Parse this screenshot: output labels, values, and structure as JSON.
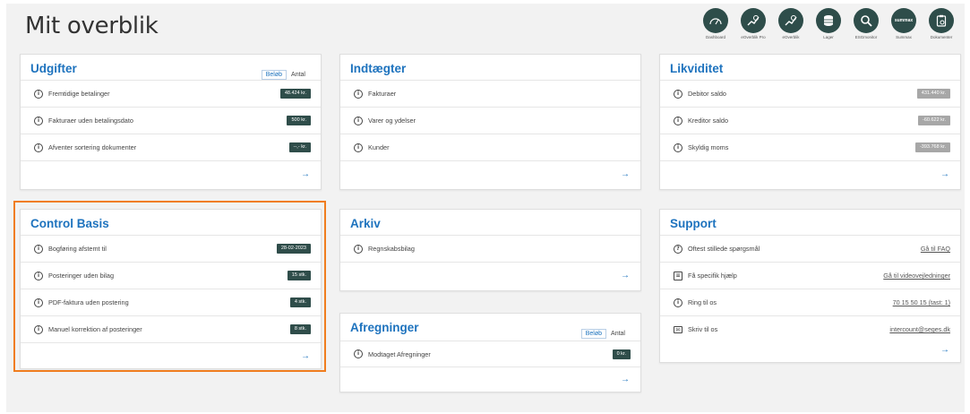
{
  "page": {
    "title": "Mit overblik"
  },
  "topnav": [
    {
      "label": "Dashboard",
      "icon": "gauge-icon"
    },
    {
      "label": "eOverblik Pro",
      "icon": "graph-pro-icon"
    },
    {
      "label": "eOverblik",
      "icon": "graph-icon"
    },
    {
      "label": "Lager",
      "icon": "database-icon"
    },
    {
      "label": "ESGmonitor",
      "icon": "magnifier-icon"
    },
    {
      "label": "Summax",
      "icon": "summax-icon"
    },
    {
      "label": "Dokumenter",
      "icon": "clipboard-icon"
    }
  ],
  "topnav_summax_text": "summax",
  "udgifter": {
    "title": "Udgifter",
    "toggle": {
      "active": "Beløb",
      "inactive": "Antal"
    },
    "rows": [
      {
        "label": "Fremtidige betalinger",
        "value": "48.424 kr."
      },
      {
        "label": "Fakturaer uden betalingsdato",
        "value": "500 kr."
      },
      {
        "label": "Afventer sortering dokumenter",
        "value": "--,- kr."
      }
    ],
    "arrow": "→"
  },
  "indtaegter": {
    "title": "Indtægter",
    "rows": [
      {
        "label": "Fakturaer"
      },
      {
        "label": "Varer og ydelser"
      },
      {
        "label": "Kunder"
      }
    ],
    "arrow": "→"
  },
  "likviditet": {
    "title": "Likviditet",
    "rows": [
      {
        "label": "Debitor saldo",
        "value": "431.440 kr."
      },
      {
        "label": "Kreditor saldo",
        "value": "-60.622 kr."
      },
      {
        "label": "Skyldig moms",
        "value": "-393.768 kr."
      }
    ],
    "arrow": "→"
  },
  "control_basis": {
    "title": "Control Basis",
    "rows": [
      {
        "label": "Bogføring afstemt til",
        "value": "28-02-2023"
      },
      {
        "label": "Posteringer uden bilag",
        "value": "15 stk."
      },
      {
        "label": "PDF-faktura uden postering",
        "value": "4 stk."
      },
      {
        "label": "Manuel korrektion af posteringer",
        "value": "8 stk."
      }
    ],
    "arrow": "→"
  },
  "arkiv": {
    "title": "Arkiv",
    "rows": [
      {
        "label": "Regnskabsbilag"
      }
    ],
    "arrow": "→"
  },
  "afregninger": {
    "title": "Afregninger",
    "toggle": {
      "active": "Beløb",
      "inactive": "Antal"
    },
    "rows": [
      {
        "label": "Modtaget Afregninger",
        "value": "0 kr."
      }
    ],
    "arrow": "→"
  },
  "support": {
    "title": "Support",
    "rows": [
      {
        "label": "Oftest stillede spørgsmål",
        "link": "Gå til FAQ",
        "icon": "question-icon"
      },
      {
        "label": "Få specifik hjælp",
        "link": "Gå til videovejledninger",
        "icon": "calendar-icon"
      },
      {
        "label": "Ring til os",
        "link": "70 15 50 15 (tast: 1)",
        "icon": "info-icon"
      },
      {
        "label": "Skriv til os",
        "link": "intercount@seges.dk",
        "icon": "mail-icon"
      }
    ],
    "arrow": "→"
  },
  "colors": {
    "accent": "#1e73be",
    "badge": "#2f4d4a",
    "badge_grey": "#a7a7a7",
    "highlight": "#f07d1f",
    "nav_circle": "#2e4d4a"
  }
}
